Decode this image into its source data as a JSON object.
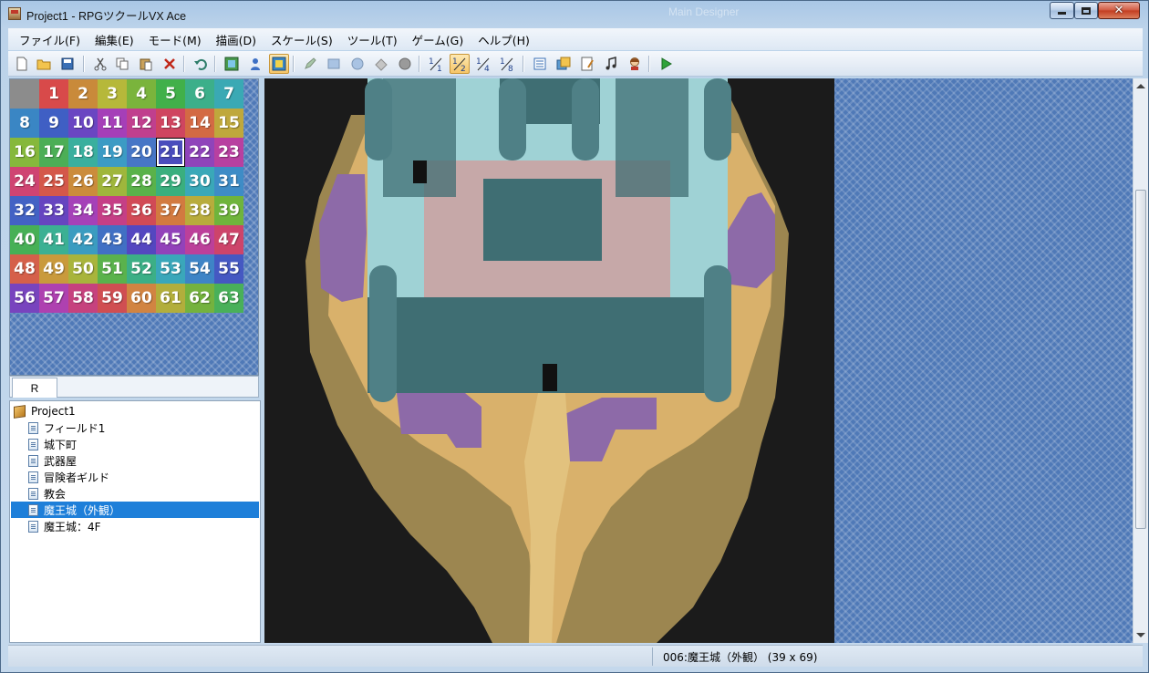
{
  "window": {
    "title": "Project1 - RPGツクールVX Ace",
    "background_watermark": "Main Designer",
    "controls": {
      "minimize": "minimize",
      "maximize": "maximize",
      "close": "✕"
    }
  },
  "menu": [
    "ファイル(F)",
    "編集(E)",
    "モード(M)",
    "描画(D)",
    "スケール(S)",
    "ツール(T)",
    "ゲーム(G)",
    "ヘルプ(H)"
  ],
  "toolbar": {
    "icons": [
      "new-project-icon",
      "open-project-icon",
      "save-project-icon",
      "cut-icon",
      "copy-icon",
      "paste-icon",
      "delete-icon",
      "undo-icon",
      "map-mode-icon",
      "event-mode-icon",
      "region-mode-icon",
      "pencil-icon",
      "rectangle-icon",
      "ellipse-icon",
      "fill-icon",
      "shadow-pen-icon",
      "scale-1-1-icon",
      "scale-1-2-icon",
      "scale-1-4-icon",
      "scale-1-8-icon",
      "database-icon",
      "resource-manager-icon",
      "script-editor-icon",
      "sound-test-icon",
      "character-generator-icon",
      "playtest-icon"
    ],
    "scale_labels": [
      "1/1",
      "1/2",
      "1/4",
      "1/8"
    ],
    "active": [
      "region-mode-icon",
      "scale-1-2-icon"
    ]
  },
  "palette": {
    "region_tiles": [
      "",
      "1",
      "2",
      "3",
      "4",
      "5",
      "6",
      "7",
      "8",
      "9",
      "10",
      "11",
      "12",
      "13",
      "14",
      "15",
      "16",
      "17",
      "18",
      "19",
      "20",
      "21",
      "22",
      "23",
      "24",
      "25",
      "26",
      "27",
      "28",
      "29",
      "30",
      "31",
      "32",
      "33",
      "34",
      "35",
      "36",
      "37",
      "38",
      "39",
      "40",
      "41",
      "42",
      "43",
      "44",
      "45",
      "46",
      "47",
      "48",
      "49",
      "50",
      "51",
      "52",
      "53",
      "54",
      "55",
      "56",
      "57",
      "58",
      "59",
      "60",
      "61",
      "62",
      "63"
    ],
    "selected_tile": "21",
    "tile_colors": [
      "#8c8c8c",
      "#d84a4a",
      "#c98a3a",
      "#b6b83a",
      "#7ab43c",
      "#41b04a",
      "#3caf8a",
      "#3aa9b4",
      "#3a86c4",
      "#3f5fc4",
      "#6a46c2",
      "#a53fb8",
      "#c03f8e",
      "#cf4560",
      "#d36a44",
      "#bfa83c",
      "#86b83c",
      "#4cae56",
      "#3aaf9e",
      "#3c9bc4",
      "#4776c6",
      "#4a4cbc",
      "#8f44ba",
      "#b840a0",
      "#cf4472",
      "#d4584a",
      "#cb8c3c",
      "#9fb63c",
      "#5ab24a",
      "#3aaf7e",
      "#3aa8b8",
      "#3e8cc6",
      "#4362c4",
      "#6645c0",
      "#a541b8",
      "#c53f86",
      "#d14a56",
      "#d27a40",
      "#b8ac3c",
      "#6fb43c",
      "#47b056",
      "#3bb093",
      "#3b9cc0",
      "#4170c4",
      "#5447c0",
      "#9242ba",
      "#bc409a",
      "#cd446a",
      "#d5604a",
      "#c99a3c",
      "#a8b43c",
      "#5ab24c",
      "#3caf86",
      "#3aa7ba",
      "#3e84c6",
      "#4558c2",
      "#7844be",
      "#ae41b0",
      "#c6427e",
      "#d04e52",
      "#d18442",
      "#b2ae3c",
      "#74b23e",
      "#49b05a"
    ]
  },
  "tabs": {
    "r_label": "R"
  },
  "map_tree": {
    "items": [
      {
        "label": "Project1",
        "type": "root"
      },
      {
        "label": "フィールド1",
        "type": "map"
      },
      {
        "label": "城下町",
        "type": "map"
      },
      {
        "label": "武器屋",
        "type": "map"
      },
      {
        "label": "冒険者ギルド",
        "type": "map"
      },
      {
        "label": "教会",
        "type": "map"
      },
      {
        "label": "魔王城（外観）",
        "type": "map",
        "selected": true
      },
      {
        "label": "魔王城：4F",
        "type": "map"
      }
    ]
  },
  "map_view": {
    "description_colors": {
      "void": "#1b1b1b",
      "sand": "#d9b16b",
      "cliff": "#9c8650",
      "castle_wall": "#3f6e73",
      "roof": "#9fd2d5",
      "floor": "#c6a8a8",
      "poison": "#8d6aa8"
    }
  },
  "status": {
    "map_info": "006:魔王城（外観） (39 x 69)"
  }
}
